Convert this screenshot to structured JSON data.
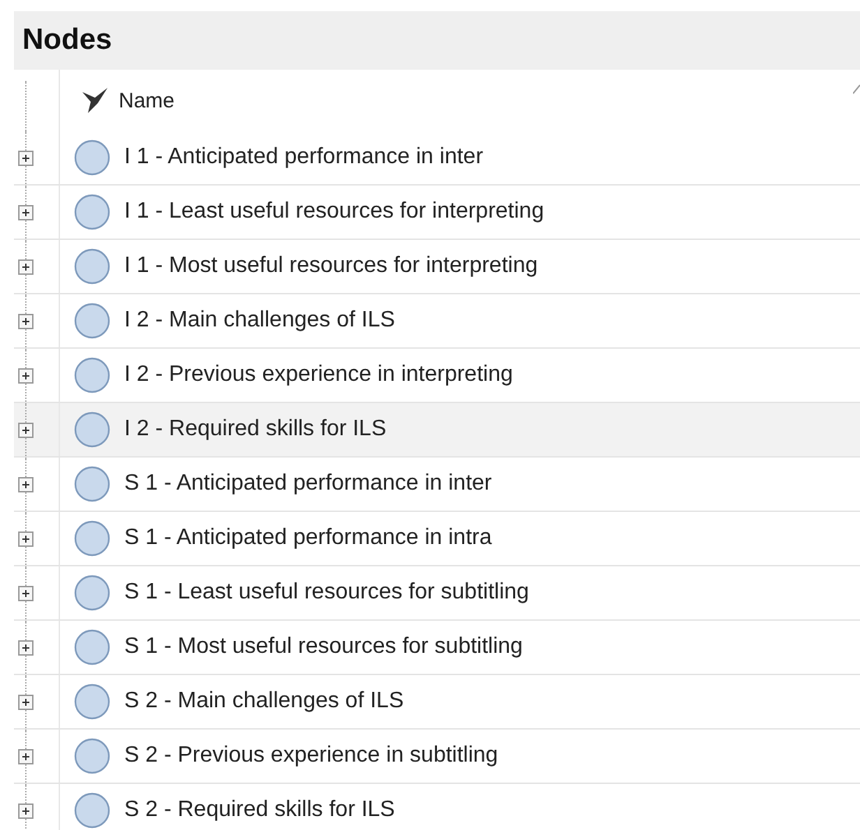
{
  "panel": {
    "title": "Nodes"
  },
  "table": {
    "columns": [
      "Name"
    ],
    "rows": [
      {
        "name": "I 1 - Anticipated performance in inter",
        "selected": false
      },
      {
        "name": "I 1 - Least useful resources for interpreting",
        "selected": false
      },
      {
        "name": "I 1 - Most useful resources for interpreting",
        "selected": false
      },
      {
        "name": "I 2 - Main challenges of ILS",
        "selected": false
      },
      {
        "name": "I 2 - Previous experience in interpreting",
        "selected": false
      },
      {
        "name": "I 2 - Required skills for ILS",
        "selected": true
      },
      {
        "name": "S 1 - Anticipated performance in inter",
        "selected": false
      },
      {
        "name": "S 1 - Anticipated performance in intra",
        "selected": false
      },
      {
        "name": "S 1 - Least useful resources for subtitling",
        "selected": false
      },
      {
        "name": "S 1 - Most useful resources for subtitling",
        "selected": false
      },
      {
        "name": "S 2 - Main challenges of ILS",
        "selected": false
      },
      {
        "name": "S 2 - Previous experience in subtitling",
        "selected": false
      },
      {
        "name": "S 2 - Required skills for ILS",
        "selected": false
      }
    ]
  }
}
